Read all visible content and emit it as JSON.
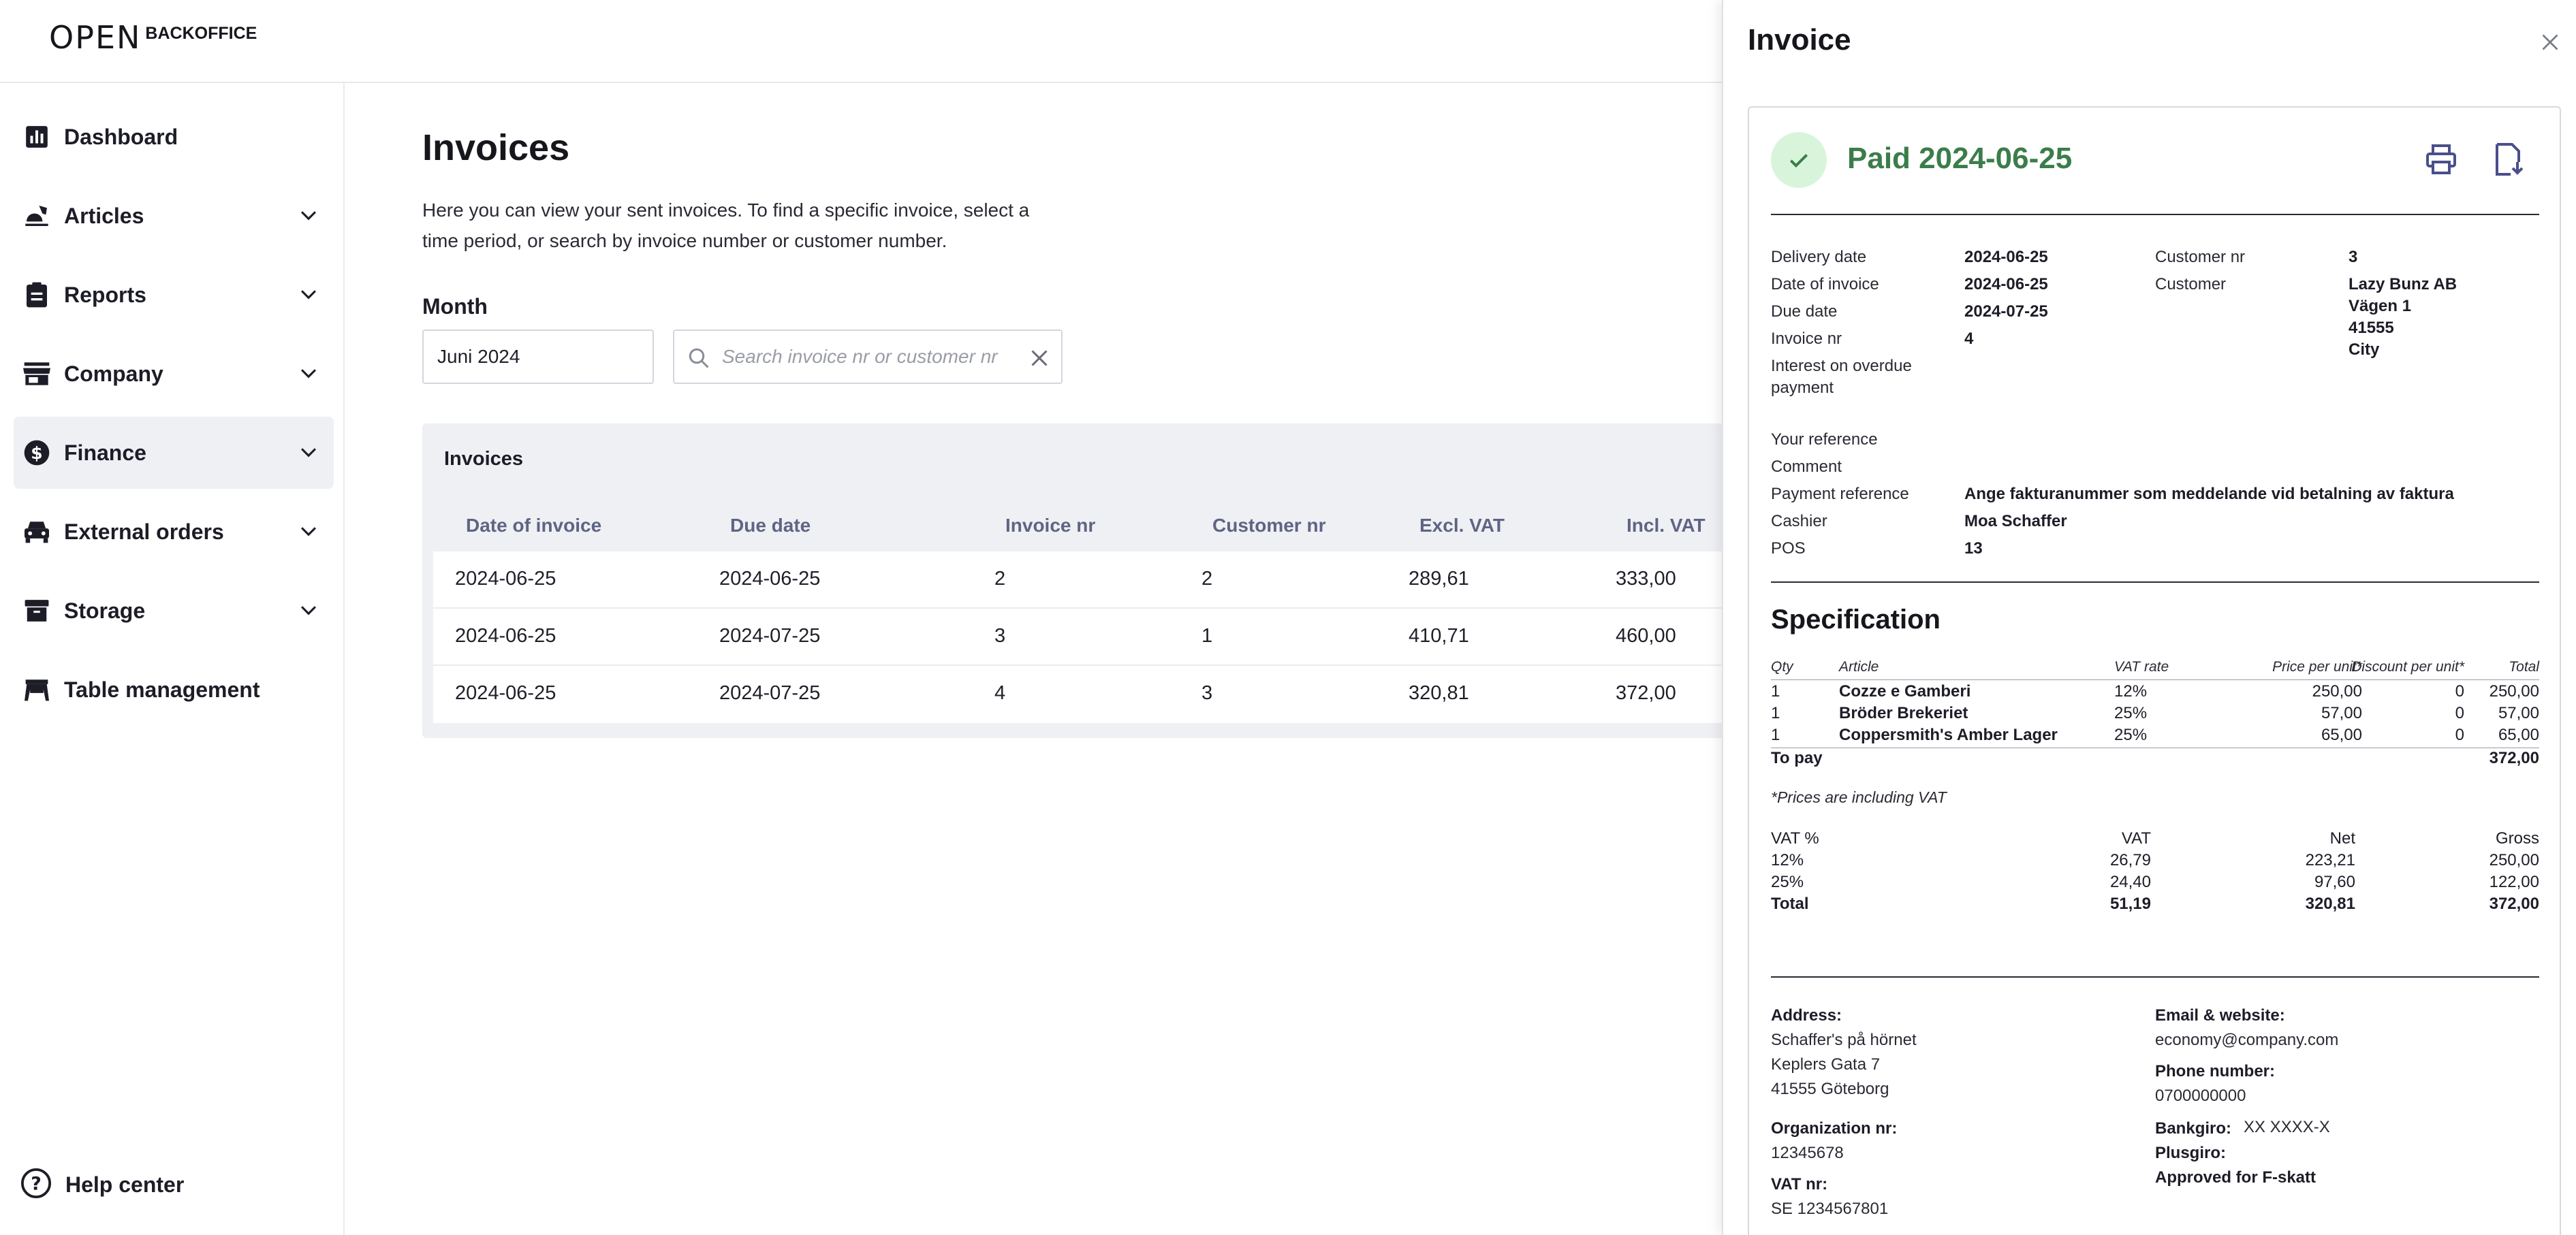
{
  "header": {
    "logo_mark": "OPEN",
    "logo_text": "BACKOFFICE"
  },
  "sidebar": {
    "items": [
      {
        "label": "Dashboard",
        "icon": "bar-chart-icon",
        "chevron": false
      },
      {
        "label": "Articles",
        "icon": "food-icon",
        "chevron": true
      },
      {
        "label": "Reports",
        "icon": "clipboard-icon",
        "chevron": true
      },
      {
        "label": "Company",
        "icon": "store-icon",
        "chevron": true
      },
      {
        "label": "Finance",
        "icon": "dollar-icon",
        "chevron": true,
        "active": true
      },
      {
        "label": "External orders",
        "icon": "car-icon",
        "chevron": true
      },
      {
        "label": "Storage",
        "icon": "archive-icon",
        "chevron": true
      },
      {
        "label": "Table management",
        "icon": "table-icon",
        "chevron": false
      }
    ],
    "help": "Help center"
  },
  "main": {
    "title": "Invoices",
    "description": "Here you can view your sent invoices. To find a specific invoice, select a time period, or search by invoice number or customer number.",
    "month_label": "Month",
    "month_value": "Juni 2024",
    "search_placeholder": "Search invoice nr or customer nr",
    "table": {
      "heading": "Invoices",
      "columns": [
        "Date of invoice",
        "Due date",
        "Invoice nr",
        "Customer nr",
        "Excl. VAT",
        "Incl. VAT"
      ],
      "rows": [
        [
          "2024-06-25",
          "2024-06-25",
          "2",
          "2",
          "289,61",
          "333,00"
        ],
        [
          "2024-06-25",
          "2024-07-25",
          "3",
          "1",
          "410,71",
          "460,00"
        ],
        [
          "2024-06-25",
          "2024-07-25",
          "4",
          "3",
          "320,81",
          "372,00"
        ]
      ]
    }
  },
  "panel": {
    "title": "Invoice",
    "status": "Paid 2024-06-25",
    "details_left": [
      {
        "label": "Delivery date",
        "value": "2024-06-25"
      },
      {
        "label": "Date of invoice",
        "value": "2024-06-25"
      },
      {
        "label": "Due date",
        "value": "2024-07-25"
      },
      {
        "label": "Invoice nr",
        "value": "4"
      },
      {
        "label": "Interest on overdue payment",
        "value": ""
      },
      {
        "label": "Your reference",
        "value": ""
      },
      {
        "label": "Comment",
        "value": ""
      },
      {
        "label": "Payment reference",
        "value": "Ange fakturanummer som meddelande vid betalning av faktura"
      },
      {
        "label": "Cashier",
        "value": "Moa Schaffer"
      },
      {
        "label": "POS",
        "value": "13"
      }
    ],
    "details_right": {
      "customer_nr_label": "Customer nr",
      "customer_nr": "3",
      "customer_label": "Customer",
      "customer_lines": [
        "Lazy Bunz AB",
        "Vägen 1",
        "41555",
        "City"
      ]
    },
    "specification": {
      "title": "Specification",
      "columns": [
        "Qty",
        "Article",
        "VAT rate",
        "Price per unit*",
        "Discount per unit*",
        "Total"
      ],
      "rows": [
        [
          "1",
          "Cozze e Gamberi",
          "12%",
          "250,00",
          "0",
          "250,00"
        ],
        [
          "1",
          "Bröder Brekeriet",
          "25%",
          "57,00",
          "0",
          "57,00"
        ],
        [
          "1",
          "Coppersmith's Amber Lager",
          "25%",
          "65,00",
          "0",
          "65,00"
        ]
      ],
      "to_pay_label": "To pay",
      "to_pay": "372,00",
      "note": "*Prices are including VAT",
      "vat_columns": [
        "VAT %",
        "VAT",
        "Net",
        "Gross"
      ],
      "vat_rows": [
        [
          "12%",
          "26,79",
          "223,21",
          "250,00"
        ],
        [
          "25%",
          "24,40",
          "97,60",
          "122,00"
        ]
      ],
      "vat_total": [
        "Total",
        "51,19",
        "320,81",
        "372,00"
      ]
    },
    "footer": {
      "address_label": "Address:",
      "address_lines": [
        "Schaffer's på hörnet",
        "Keplers Gata 7",
        "41555 Göteborg"
      ],
      "org_label": "Organization nr:",
      "org_value": "12345678",
      "vat_label": "VAT nr:",
      "vat_value": "SE 1234567801",
      "email_label": "Email & website:",
      "email_value": "economy@company.com",
      "phone_label": "Phone number:",
      "phone_value": "0700000000",
      "bankgiro_label": "Bankgiro:",
      "bankgiro_value": "XX XXXX-X",
      "plusgiro_label": "Plusgiro:",
      "fskatt": "Approved for F-skatt"
    }
  },
  "colors": {
    "paid_green": "#3b7d4a",
    "paid_badge_bg": "#d8f5dc",
    "table_header_text": "#5f6484",
    "icon_accent": "#4a4f8a"
  }
}
